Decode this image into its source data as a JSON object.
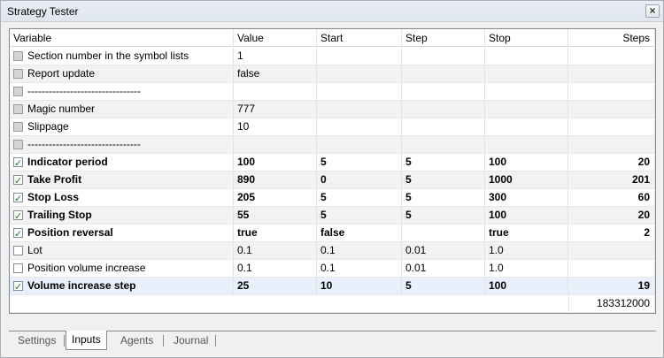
{
  "window": {
    "title": "Strategy Tester"
  },
  "columns": [
    "Variable",
    "Value",
    "Start",
    "Step",
    "Stop",
    "Steps"
  ],
  "rows": [
    {
      "checked": false,
      "bold": false,
      "variable": "Section number in the symbol lists",
      "value": "1",
      "start": "",
      "step": "",
      "stop": "",
      "steps": ""
    },
    {
      "checked": false,
      "bold": false,
      "variable": "Report update",
      "value": "false",
      "start": "",
      "step": "",
      "stop": "",
      "steps": ""
    },
    {
      "checked": false,
      "bold": false,
      "variable": "--------------------------------",
      "value": "",
      "start": "",
      "step": "",
      "stop": "",
      "steps": ""
    },
    {
      "checked": false,
      "bold": false,
      "variable": "Magic number",
      "value": "777",
      "start": "",
      "step": "",
      "stop": "",
      "steps": ""
    },
    {
      "checked": false,
      "bold": false,
      "variable": "Slippage",
      "value": "10",
      "start": "",
      "step": "",
      "stop": "",
      "steps": ""
    },
    {
      "checked": false,
      "bold": false,
      "variable": "--------------------------------",
      "value": "",
      "start": "",
      "step": "",
      "stop": "",
      "steps": ""
    },
    {
      "checked": true,
      "bold": true,
      "variable": "Indicator period",
      "value": "100",
      "start": "5",
      "step": "5",
      "stop": "100",
      "steps": "20"
    },
    {
      "checked": true,
      "bold": true,
      "variable": "Take Profit",
      "value": "890",
      "start": "0",
      "step": "5",
      "stop": "1000",
      "steps": "201"
    },
    {
      "checked": true,
      "bold": true,
      "variable": "Stop Loss",
      "value": "205",
      "start": "5",
      "step": "5",
      "stop": "300",
      "steps": "60"
    },
    {
      "checked": true,
      "bold": true,
      "variable": "Trailing Stop",
      "value": "55",
      "start": "5",
      "step": "5",
      "stop": "100",
      "steps": "20"
    },
    {
      "checked": true,
      "bold": true,
      "variable": "Position reversal",
      "value": "true",
      "start": "false",
      "step": "",
      "stop": "true",
      "steps": "2"
    },
    {
      "checked": false,
      "bold": false,
      "variable": "Lot",
      "value": "0.1",
      "start": "0.1",
      "step": "0.01",
      "stop": "1.0",
      "steps": ""
    },
    {
      "checked": false,
      "bold": false,
      "variable": "Position volume increase",
      "value": "0.1",
      "start": "0.1",
      "step": "0.01",
      "stop": "1.0",
      "steps": ""
    },
    {
      "checked": true,
      "bold": true,
      "variable": "Volume increase step",
      "value": "25",
      "start": "10",
      "step": "5",
      "stop": "100",
      "steps": "19"
    }
  ],
  "total_steps": "183312000",
  "tabs": [
    {
      "label": "Settings",
      "active": false
    },
    {
      "label": "Inputs",
      "active": true
    },
    {
      "label": "Agents",
      "active": false
    },
    {
      "label": "Journal",
      "active": false
    }
  ]
}
